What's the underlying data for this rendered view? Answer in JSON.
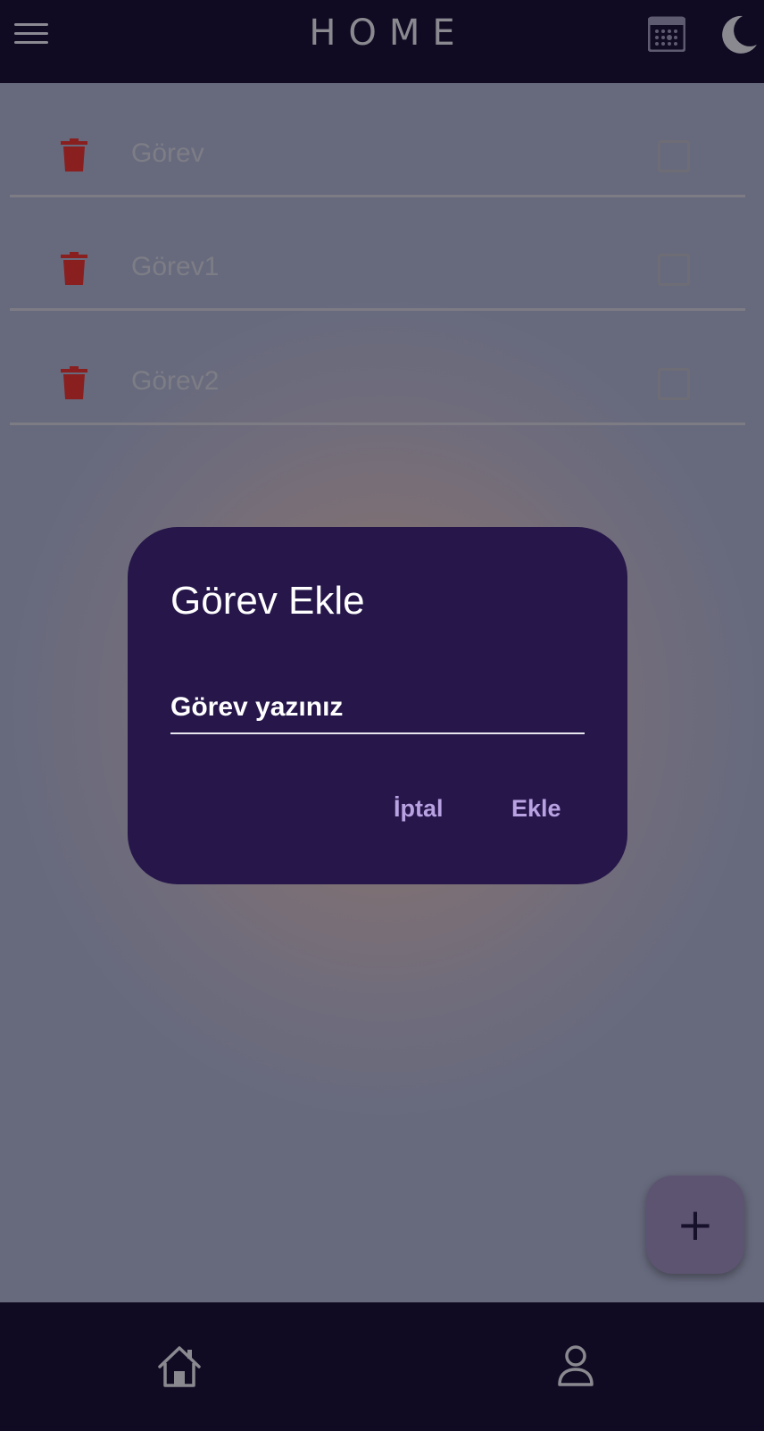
{
  "header": {
    "title": "HOME",
    "menu_icon": "menu-icon",
    "calendar_icon": "calendar-icon",
    "theme_icon": "moon-icon"
  },
  "tasks": [
    {
      "label": "Görev",
      "checked": false
    },
    {
      "label": "Görev1",
      "checked": false
    },
    {
      "label": "Görev2",
      "checked": false
    }
  ],
  "dialog": {
    "title": "Görev Ekle",
    "input_placeholder": "Görev yazınız",
    "input_value": "",
    "cancel_label": "İptal",
    "add_label": "Ekle"
  },
  "fab": {
    "label": "+"
  },
  "bottom_nav": {
    "items": [
      {
        "icon": "home-icon"
      },
      {
        "icon": "profile-icon"
      }
    ]
  },
  "colors": {
    "bar_bg": "#100a22",
    "dialog_bg": "#26164a",
    "accent": "#b9a2e2",
    "trash": "#8a1f1f"
  }
}
